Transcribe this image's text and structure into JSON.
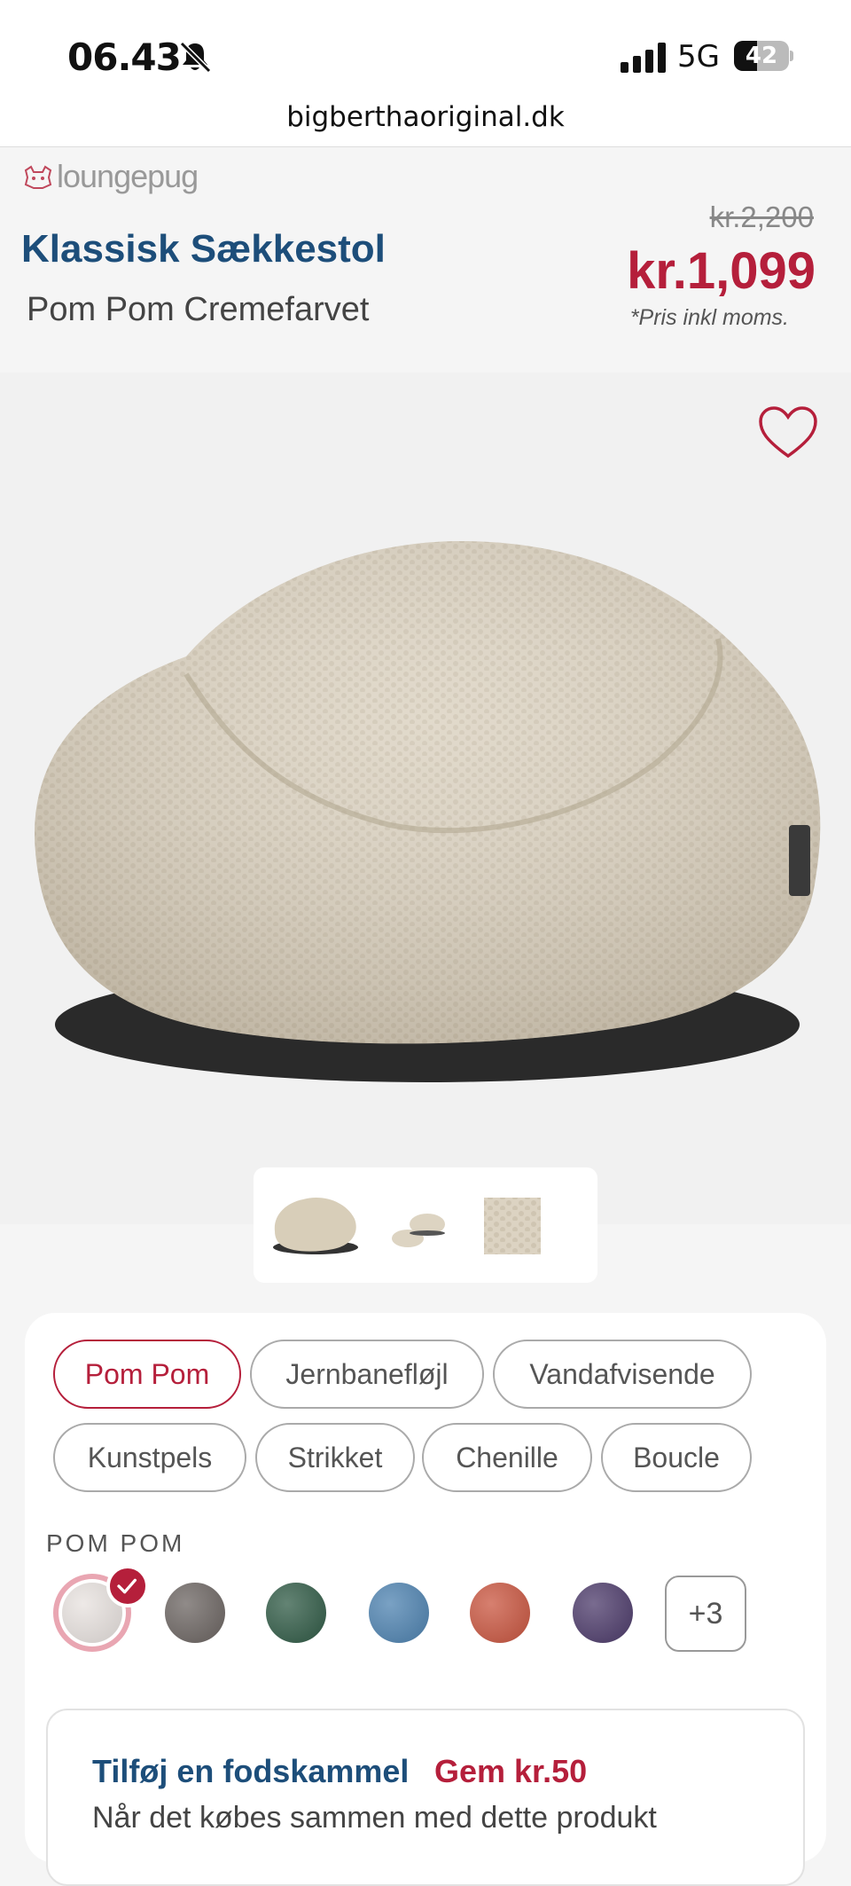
{
  "status": {
    "time": "06.43",
    "network": "5G",
    "battery": "42",
    "battery_level": 0.42
  },
  "browser": {
    "url": "bigberthaoriginal.dk"
  },
  "brand": {
    "logo_text": "loungepug"
  },
  "product": {
    "title": "Klassisk Sækkestol",
    "subtitle": "Pom Pom Cremefarvet",
    "old_price": "kr.2,200",
    "price": "kr.1,099",
    "vat_note": "*Pris inkl moms."
  },
  "fabrics": {
    "items": [
      "Pom Pom",
      "Jernbanefløjl",
      "Vandafvisende",
      "Kunstpels",
      "Strikket",
      "Chenille",
      "Boucle"
    ],
    "selected": "Pom Pom"
  },
  "swatches": {
    "label": "POM POM",
    "colors": [
      "#e8e2df",
      "#6b6461",
      "#2f5a45",
      "#4d82b0",
      "#c9553f",
      "#4c3a6a"
    ],
    "more_label": "+3"
  },
  "addon": {
    "title": "Tilføj en fodskammel",
    "save": "Gem kr.50",
    "description": "Når det købes sammen med dette produkt"
  },
  "colors": {
    "accent": "#b51f3b",
    "title_blue": "#1d4e7a"
  }
}
